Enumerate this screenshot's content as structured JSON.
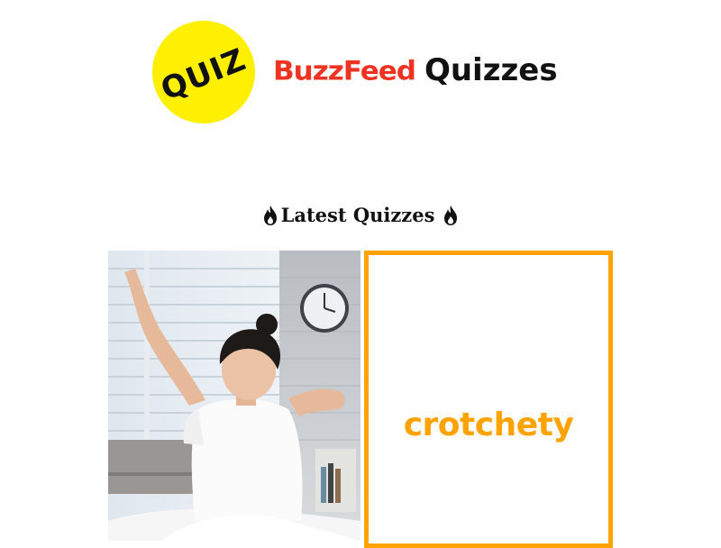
{
  "header": {
    "badge_text": "QUIZ",
    "brand_name": "BuzzFeed",
    "brand_suffix": "Quizzes"
  },
  "section": {
    "title": "Latest Quizzes"
  },
  "cards": [
    {
      "image": "woman-stretching-in-bedroom-photo"
    },
    {
      "word": "crotchety",
      "accent": "#ffa300"
    }
  ],
  "colors": {
    "badge": "#ffef00",
    "brand_red": "#ee3322",
    "accent_orange": "#ffa300"
  },
  "icons": [
    "flame-icon"
  ]
}
